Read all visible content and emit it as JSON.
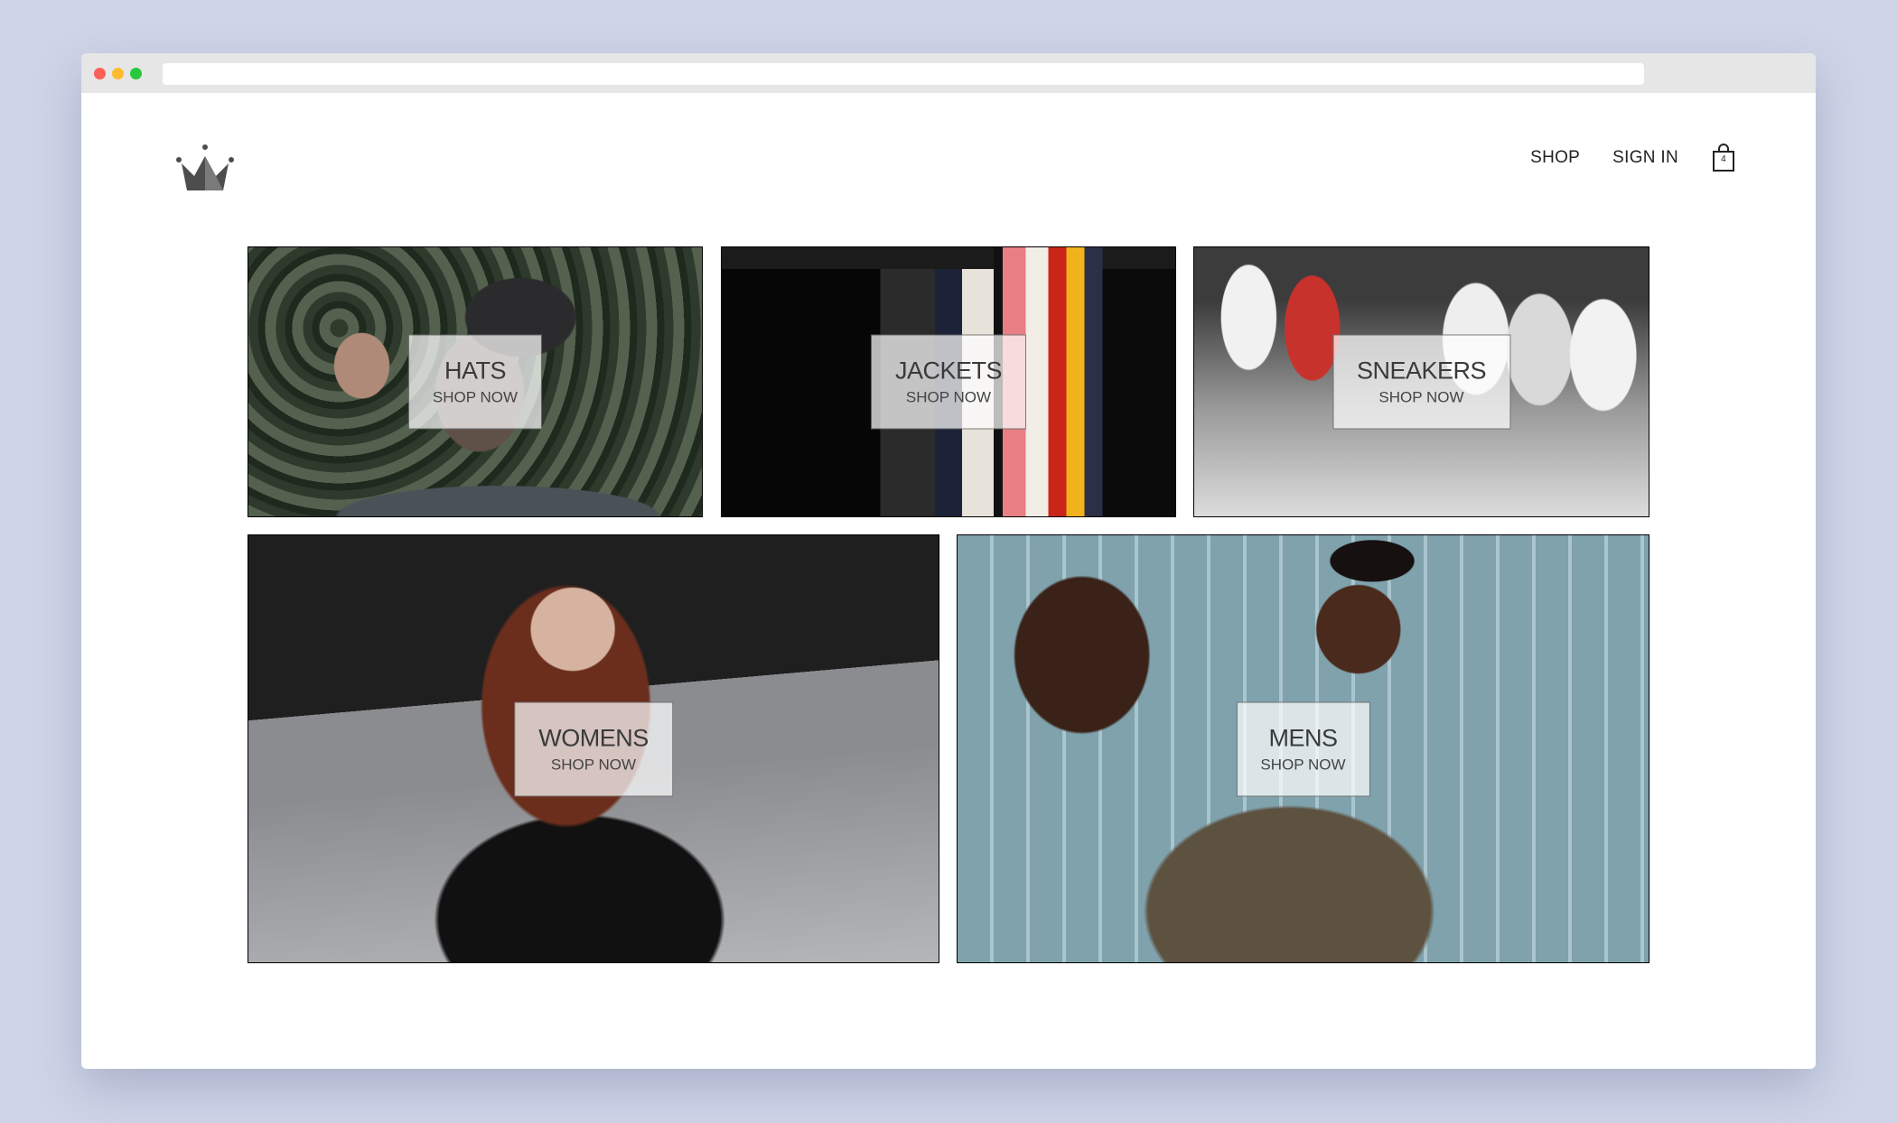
{
  "header": {
    "logo_icon": "crown-icon",
    "nav": {
      "shop_label": "SHOP",
      "sign_in_label": "SIGN IN",
      "cart_icon": "shopping-bag-icon",
      "cart_count": "4"
    }
  },
  "categories": [
    {
      "title": "HATS",
      "cta": "SHOP NOW"
    },
    {
      "title": "JACKETS",
      "cta": "SHOP NOW"
    },
    {
      "title": "SNEAKERS",
      "cta": "SHOP NOW"
    },
    {
      "title": "WOMENS",
      "cta": "SHOP NOW"
    },
    {
      "title": "MENS",
      "cta": "SHOP NOW"
    }
  ]
}
